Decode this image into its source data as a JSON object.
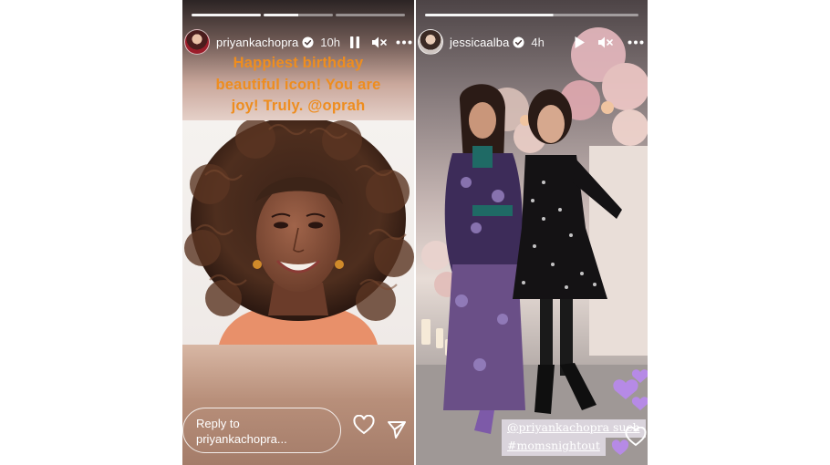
{
  "left_story": {
    "username": "priyankachopra",
    "time": "10h",
    "caption_lines": [
      "Happiest birthday",
      "beautiful icon! You are",
      "joy! Truly. @oprah"
    ],
    "reply_placeholder_line1": "Reply to",
    "reply_placeholder_line2": "priyankachopra...",
    "progress": [
      1,
      0.5,
      0
    ],
    "icons": {
      "pause": "pause-icon",
      "mute": "mute-icon",
      "more": "more-icon",
      "like": "heart-icon",
      "share": "send-icon"
    }
  },
  "right_story": {
    "username": "jessicaalba",
    "time": "4h",
    "mention_text": "@priyankachopra such",
    "hashtag_text": "#momsnightout",
    "progress": [
      0.6
    ],
    "icons": {
      "play": "play-icon",
      "mute": "mute-icon",
      "more": "more-icon",
      "like": "heart-icon"
    }
  },
  "colors": {
    "caption_orange": "#ee8d1f",
    "verified_blue": "#3897f0",
    "emoji_purple": "#b68ae6"
  }
}
